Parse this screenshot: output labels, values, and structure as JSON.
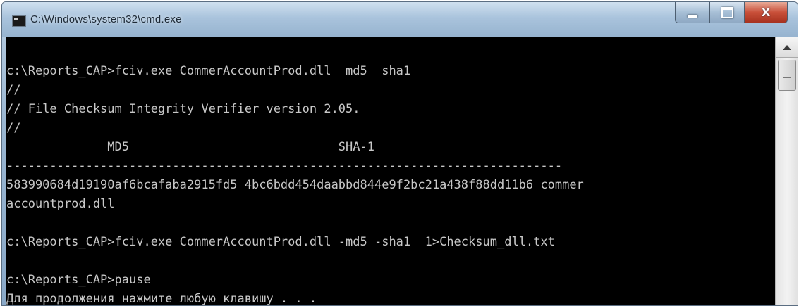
{
  "window": {
    "title": "C:\\Windows\\system32\\cmd.exe",
    "icon": "cmd-window-icon"
  },
  "controls": {
    "close_glyph": "X"
  },
  "console": {
    "foreground": "#c8c8c8",
    "background": "#000000",
    "lines": [
      "c:\\Reports_CAP>fciv.exe CommerAccountProd.dll  md5  sha1",
      "//",
      "// File Checksum Integrity Verifier version 2.05.",
      "//",
      "              MD5                             SHA-1",
      "-----------------------------------------------------------------------------",
      "583990684d19190af6bcafaba2915fd5 4bc6bdd454daabbd844e9f2bc21a438f88dd11b6 commer",
      "accountprod.dll",
      "",
      "c:\\Reports_CAP>fciv.exe CommerAccountProd.dll -md5 -sha1  1>Checksum_dll.txt",
      "",
      "c:\\Reports_CAP>pause",
      "Для продолжения нажмите любую клавишу . . ."
    ]
  }
}
